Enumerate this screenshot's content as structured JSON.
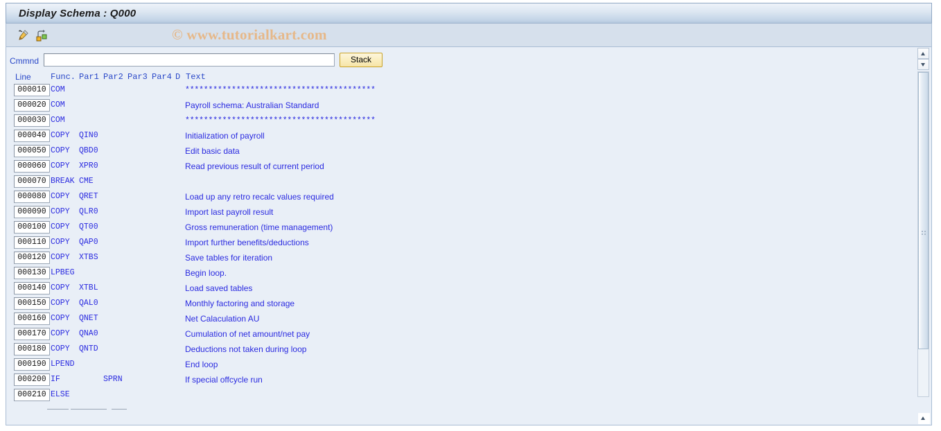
{
  "window": {
    "title": "Display Schema : Q000"
  },
  "toolbar": {
    "icons": [
      {
        "name": "edit-pen-icon",
        "label": "Edit"
      },
      {
        "name": "structure-icon",
        "label": "Structure"
      }
    ]
  },
  "watermark": {
    "text": "© www.tutorialkart.com",
    "color": "#e7b684"
  },
  "command": {
    "label": "Cmmnd",
    "value": "",
    "placeholder": "",
    "stack_label": "Stack"
  },
  "grid": {
    "headers": {
      "line": "Line",
      "func": "Func.",
      "par1": "Par1",
      "par2": "Par2",
      "par3": "Par3",
      "par4": "Par4",
      "d": "D",
      "text": "Text"
    },
    "rows": [
      {
        "line": "000010",
        "func": "COM",
        "par1": "",
        "par2": "",
        "par3": "",
        "par4": "",
        "d": "",
        "text": "*****************************************",
        "stars": true
      },
      {
        "line": "000020",
        "func": "COM",
        "par1": "",
        "par2": "",
        "par3": "",
        "par4": "",
        "d": "",
        "text": "Payroll schema: Australian Standard",
        "stars": false
      },
      {
        "line": "000030",
        "func": "COM",
        "par1": "",
        "par2": "",
        "par3": "",
        "par4": "",
        "d": "",
        "text": "*****************************************",
        "stars": true
      },
      {
        "line": "000040",
        "func": "COPY",
        "par1": "QIN0",
        "par2": "",
        "par3": "",
        "par4": "",
        "d": "",
        "text": "Initialization of payroll",
        "stars": false
      },
      {
        "line": "000050",
        "func": "COPY",
        "par1": "QBD0",
        "par2": "",
        "par3": "",
        "par4": "",
        "d": "",
        "text": "Edit basic data",
        "stars": false
      },
      {
        "line": "000060",
        "func": "COPY",
        "par1": "XPR0",
        "par2": "",
        "par3": "",
        "par4": "",
        "d": "",
        "text": "Read previous result of current period",
        "stars": false
      },
      {
        "line": "000070",
        "func": "BREAK",
        "par1": "CME",
        "par2": "",
        "par3": "",
        "par4": "",
        "d": "",
        "text": "",
        "stars": false
      },
      {
        "line": "000080",
        "func": "COPY",
        "par1": "QRET",
        "par2": "",
        "par3": "",
        "par4": "",
        "d": "",
        "text": "Load up any retro recalc values required",
        "stars": false
      },
      {
        "line": "000090",
        "func": "COPY",
        "par1": "QLR0",
        "par2": "",
        "par3": "",
        "par4": "",
        "d": "",
        "text": "Import last payroll result",
        "stars": false
      },
      {
        "line": "000100",
        "func": "COPY",
        "par1": "QT00",
        "par2": "",
        "par3": "",
        "par4": "",
        "d": "",
        "text": "Gross remuneration (time management)",
        "stars": false
      },
      {
        "line": "000110",
        "func": "COPY",
        "par1": "QAP0",
        "par2": "",
        "par3": "",
        "par4": "",
        "d": "",
        "text": "Import further benefits/deductions",
        "stars": false
      },
      {
        "line": "000120",
        "func": "COPY",
        "par1": "XTBS",
        "par2": "",
        "par3": "",
        "par4": "",
        "d": "",
        "text": "Save tables for iteration",
        "stars": false
      },
      {
        "line": "000130",
        "func": "LPBEG",
        "par1": "",
        "par2": "",
        "par3": "",
        "par4": "",
        "d": "",
        "text": "Begin loop.",
        "stars": false
      },
      {
        "line": "000140",
        "func": "COPY",
        "par1": "XTBL",
        "par2": "",
        "par3": "",
        "par4": "",
        "d": "",
        "text": "Load saved tables",
        "stars": false
      },
      {
        "line": "000150",
        "func": "COPY",
        "par1": "QAL0",
        "par2": "",
        "par3": "",
        "par4": "",
        "d": "",
        "text": "Monthly factoring and storage",
        "stars": false
      },
      {
        "line": "000160",
        "func": "COPY",
        "par1": "QNET",
        "par2": "",
        "par3": "",
        "par4": "",
        "d": "",
        "text": "Net Calaculation AU",
        "stars": false
      },
      {
        "line": "000170",
        "func": "COPY",
        "par1": "QNA0",
        "par2": "",
        "par3": "",
        "par4": "",
        "d": "",
        "text": "Cumulation of net amount/net pay",
        "stars": false
      },
      {
        "line": "000180",
        "func": "COPY",
        "par1": "QNTD",
        "par2": "",
        "par3": "",
        "par4": "",
        "d": "",
        "text": "Deductions not taken during loop",
        "stars": false
      },
      {
        "line": "000190",
        "func": "LPEND",
        "par1": "",
        "par2": "",
        "par3": "",
        "par4": "",
        "d": "",
        "text": "End loop",
        "stars": false
      },
      {
        "line": "000200",
        "func": "IF",
        "par1": "",
        "par2": "SPRN",
        "par3": "",
        "par4": "",
        "d": "",
        "text": "If special offcycle run",
        "stars": false
      },
      {
        "line": "000210",
        "func": "ELSE",
        "par1": "",
        "par2": "",
        "par3": "",
        "par4": "",
        "d": "",
        "text": "",
        "stars": false
      }
    ]
  },
  "scrollbar": {
    "up_label": "scroll up",
    "down_label": "scroll down"
  }
}
